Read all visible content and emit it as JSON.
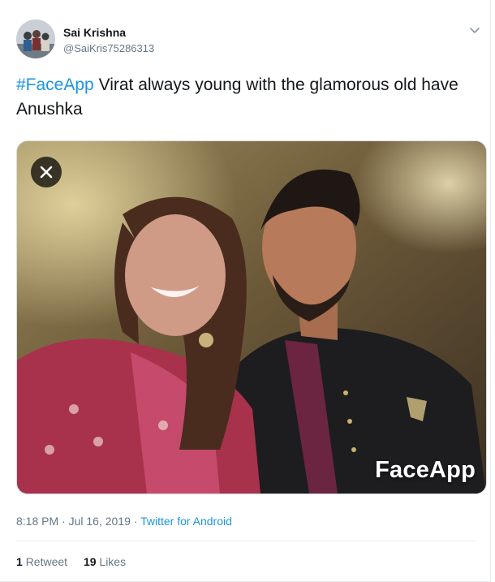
{
  "tweet": {
    "author": {
      "display_name": "Sai Krishna",
      "handle": "@SaiKris75286313"
    },
    "text": {
      "hashtag": "#FaceApp",
      "body": " Virat always young with the glamorous old have Anushka"
    },
    "media": {
      "watermark": "FaceApp",
      "close_icon": "close-icon"
    },
    "meta": {
      "timestamp": "8:18 PM · Jul 16, 2019",
      "separator": " · ",
      "source": "Twitter for Android"
    },
    "stats": {
      "retweets_count": "1",
      "retweets_label": "Retweet",
      "likes_count": "19",
      "likes_label": "Likes"
    }
  },
  "colors": {
    "link": "#1b95e0",
    "secondary_text": "#657786",
    "primary_text": "#14171a",
    "divider": "#e6ecf0"
  }
}
